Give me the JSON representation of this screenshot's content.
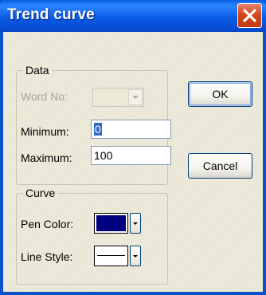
{
  "window": {
    "title": "Trend curve"
  },
  "data_group": {
    "title": "Data",
    "word_no_label": "Word No:",
    "word_no_value": "",
    "minimum_label": "Minimum:",
    "minimum_value": "0",
    "maximum_label": "Maximum:",
    "maximum_value": "100"
  },
  "curve_group": {
    "title": "Curve",
    "pen_color_label": "Pen Color:",
    "pen_color": "#000080",
    "line_style_label": "Line Style:"
  },
  "buttons": {
    "ok": "OK",
    "cancel": "Cancel"
  },
  "icons": {
    "close": "close-icon",
    "combo_arrow": "chevron-down-icon",
    "dropdown_arrow": "chevron-down-icon"
  },
  "colors": {
    "titlebar": "#0a5fe0",
    "close_button": "#d6461d",
    "dialog_background": "#ece9d8",
    "selection": "#316ac5"
  }
}
